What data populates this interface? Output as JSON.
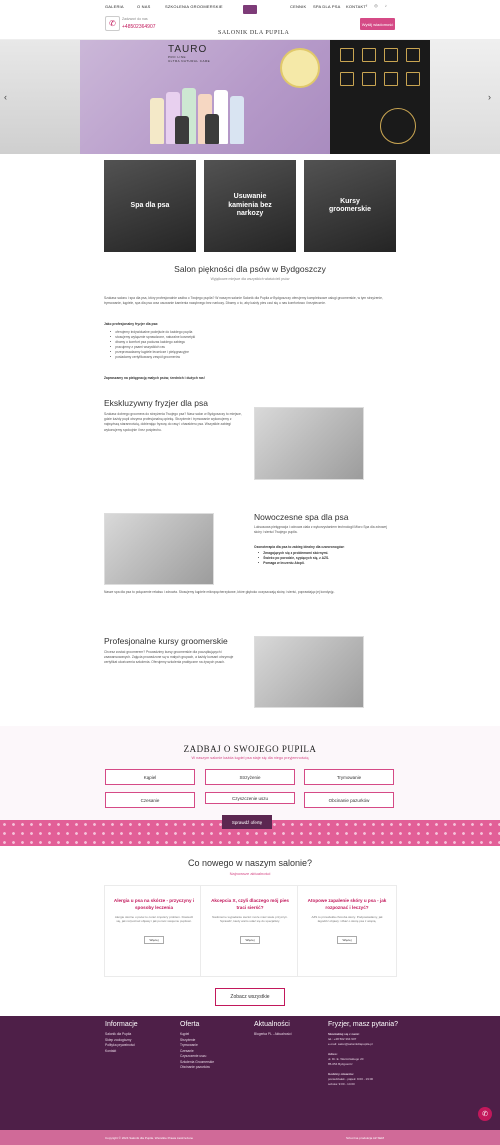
{
  "header": {
    "nav_left": [
      "GALERIA",
      "O NAS",
      "SZKOLENIA GROOMERSKIE"
    ],
    "nav_right": [
      "CENNIK",
      "SPA DLA PSA",
      "KONTAKT"
    ],
    "logo_text": "SALONIK DLA PUPILA",
    "phone_label": "Zadzwoń do nas",
    "phone": "+48502364907",
    "cta": "Wyślij wiadomość"
  },
  "hero": {
    "brand": "TAURO",
    "brand_sub": "PRO LINE",
    "brand_tag": "ULTRA NATURAL CARE"
  },
  "tiles": [
    "Spa dla psa",
    "Usuwanie kamienia bez narkozy",
    "Kursy groomerskie"
  ],
  "intro": {
    "title": "Salon piękności dla psów w Bydgoszczy",
    "subtitle": "Wyjątkowe miejsce dla wszystkich właścicieli psów",
    "p1": "Szukasz salonu i spa dla psa, który profesjonalnie zadba o Twojego pupila? W naszym salonie Salonik dla Pupila w Bydgoszczy oferujemy kompleksowe usługi groomerskie, w tym strzyżenie, trymowanie, kąpiele, spa dla psa oraz usuwanie kamienia nazębnego bez narkozy. Dbamy o to, aby każdy pies czuł się u nas komfortowo i bezpiecznie.",
    "list_title": "Jako profesjonalny fryzjer dla psa:",
    "bullets": [
      "oferujemy indywidualne podejście do każdego pupila",
      "stosujemy wyłącznie sprawdzone, naturalne kosmetyki",
      "dbamy o komfort psa podczas każdego zabiegu",
      "pracujemy z psami wszystkich ras",
      "przeprowadzamy kąpiele lecznicze i pielęgnacyjne",
      "posiadamy certyfikowany zespół groomerów"
    ],
    "closing": "Zapraszamy na pielęgnację małych psów, średnich i dużych ras!"
  },
  "sections": [
    {
      "title": "Ekskluzywny fryzjer dla psa",
      "text": "Szukasz dobrego groomera do strzyżenia Twojego psa? Nasz salon w Bydgoszczy to miejsce, gdzie każdy pupil otrzyma profesjonalną opiekę. Strzyżenie i trymowanie wykonujemy z najwyższą starannością, dobierając fryzurę do rasy i charakteru psa. Wszystkie zabiegi wykonujemy spokojnie i bez pośpiechu."
    },
    {
      "title": "Nowoczesne spa dla psa",
      "text": "Luksusowa pielęgnacja i odnowa ciała z wykorzystaniem technologii Micro Spa dla zdrowej skóry i sierści Twojego pupila.",
      "list_title": "Ozonoterapia dla psa to zabieg idealny dla czworonogów:",
      "bullets": [
        "Zmagających się z problemami skórnymi.",
        "Świeżo po porodzie, sypiących się, z AZS.",
        "Pomaga w leczeniu Atopii."
      ],
      "after": "Nasze spa dla psa to połączenie relaksu i zdrowia. Stosujemy kąpiele mikropęcherzykowe, które głęboko oczyszczają skórę i sierść, poprawiając jej kondycję."
    },
    {
      "title": "Profesjonalne kursy groomerskie",
      "text": "Chcesz zostać groomerem? Prowadzimy kursy groomerskie dla początkujących i zaawansowanych. Zajęcia prowadzone są w małych grupach, a każdy kursant otrzymuje certyfikat ukończenia szkolenia. Oferujemy szkolenia praktyczne na żywych psach."
    }
  ],
  "categories": {
    "title": "ZADBAJ O SWOJEGO PUPILA",
    "subtitle": "W naszym salonie każda kąpiel psa staje się dla niego przyjemnością",
    "items": [
      "Kąpiel",
      "Strzyżenie",
      "Trymowanie",
      "Czesanie",
      "Czyszczenie uszu",
      "Obcinanie pazurków"
    ],
    "offer": "Sprawdź ofertę"
  },
  "news": {
    "title": "Co nowego w naszym salonie?",
    "subtitle": "Najnowsze aktualności",
    "cards": [
      {
        "title": "Alergia u psa na skórze - przyczyny i sposoby leczenia",
        "excerpt": "Alergie skórne u psów to coraz częstszy problem. Dowiedz się, jak rozpoznać objawy i jak pomóc swojemu pupilowi.",
        "btn": "Więcej"
      },
      {
        "title": "Akcepcia X, czyli dlaczego mój pies traci sierść?",
        "excerpt": "Nadmierne wypadanie sierści może mieć wiele przyczyn. Sprawdź, kiedy warto udać się do specjalisty.",
        "btn": "Więcej"
      },
      {
        "title": "Atopowe zapalenie skóry u psa - jak rozpoznać i leczyć?",
        "excerpt": "AZS to przewlekła choroba skóry. Podpowiadamy, jak łagodzić objawy i dbać o skórę psa z atopią.",
        "btn": "Więcej"
      }
    ],
    "see_all": "Zobacz wszystkie"
  },
  "footer": {
    "col1_title": "Informacje",
    "col1": [
      "Salonik dla Pupila",
      "Sklep zoologiczny",
      "Polityka prywatności",
      "Kontakt"
    ],
    "col2_title": "Oferta",
    "col2": [
      "Kąpiel",
      "Strzyżenie",
      "Trymowanie",
      "Czesanie",
      "Czyszczenie uszu",
      "Szkolenia Groomerskie",
      "Obcinanie pazurków"
    ],
    "col3_title": "Aktualności",
    "col3": [
      "Blogerka PL - Aktualności"
    ],
    "col4_title": "Fryzjer, masz pytania?",
    "col4": [
      "Skontaktuj się z nami:",
      "tel.: +48 502 364 907",
      "e-mail: salon@salonikdlapupila.pl",
      "Adres:",
      "ul. Dr. E. Warmińskiego 20",
      "85-054 Bydgoszcz",
      "Godziny otwarcia:",
      "poniedziałek - piątek: 9:00 - 19:00",
      "sobota: 9:00 - 14:00"
    ],
    "copyright": "Copyright © 2024 Salonik dla Pupila. Wszelkie Prawa zastrzeżone",
    "credit": "Sztuczna produkcja AZ SEM"
  }
}
